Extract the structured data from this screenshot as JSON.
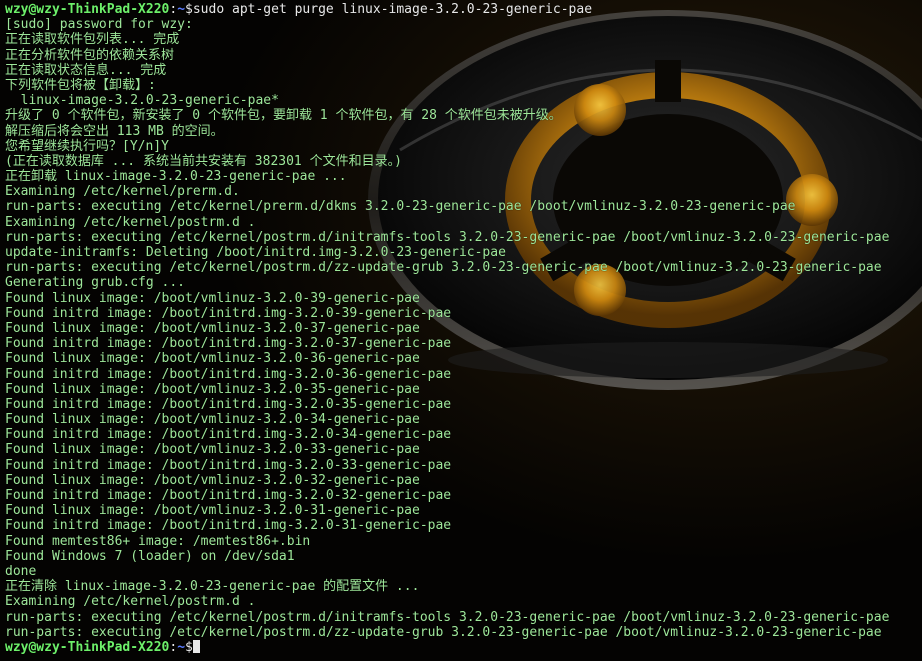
{
  "terminal": {
    "prompt_user": "wzy@wzy-ThinkPad-X220",
    "prompt_sep": ":",
    "prompt_path": "~",
    "prompt_dollar": "$",
    "command": "sudo apt-get purge linux-image-3.2.0-23-generic-pae",
    "output": [
      "[sudo] password for wzy:",
      "正在读取软件包列表... 完成",
      "正在分析软件包的依赖关系树",
      "正在读取状态信息... 完成",
      "下列软件包将被【卸载】:",
      "  linux-image-3.2.0-23-generic-pae*",
      "升级了 0 个软件包，新安装了 0 个软件包，要卸载 1 个软件包，有 28 个软件包未被升级。",
      "解压缩后将会空出 113 MB 的空间。",
      "您希望继续执行吗？[Y/n]Y",
      "(正在读取数据库 ... 系统当前共安装有 382301 个文件和目录。)",
      "正在卸载 linux-image-3.2.0-23-generic-pae ...",
      "Examining /etc/kernel/prerm.d.",
      "run-parts: executing /etc/kernel/prerm.d/dkms 3.2.0-23-generic-pae /boot/vmlinuz-3.2.0-23-generic-pae",
      "Examining /etc/kernel/postrm.d .",
      "run-parts: executing /etc/kernel/postrm.d/initramfs-tools 3.2.0-23-generic-pae /boot/vmlinuz-3.2.0-23-generic-pae",
      "update-initramfs: Deleting /boot/initrd.img-3.2.0-23-generic-pae",
      "run-parts: executing /etc/kernel/postrm.d/zz-update-grub 3.2.0-23-generic-pae /boot/vmlinuz-3.2.0-23-generic-pae",
      "Generating grub.cfg ...",
      "Found linux image: /boot/vmlinuz-3.2.0-39-generic-pae",
      "Found initrd image: /boot/initrd.img-3.2.0-39-generic-pae",
      "Found linux image: /boot/vmlinuz-3.2.0-37-generic-pae",
      "Found initrd image: /boot/initrd.img-3.2.0-37-generic-pae",
      "Found linux image: /boot/vmlinuz-3.2.0-36-generic-pae",
      "Found initrd image: /boot/initrd.img-3.2.0-36-generic-pae",
      "Found linux image: /boot/vmlinuz-3.2.0-35-generic-pae",
      "Found initrd image: /boot/initrd.img-3.2.0-35-generic-pae",
      "Found linux image: /boot/vmlinuz-3.2.0-34-generic-pae",
      "Found initrd image: /boot/initrd.img-3.2.0-34-generic-pae",
      "Found linux image: /boot/vmlinuz-3.2.0-33-generic-pae",
      "Found initrd image: /boot/initrd.img-3.2.0-33-generic-pae",
      "Found linux image: /boot/vmlinuz-3.2.0-32-generic-pae",
      "Found initrd image: /boot/initrd.img-3.2.0-32-generic-pae",
      "Found linux image: /boot/vmlinuz-3.2.0-31-generic-pae",
      "Found initrd image: /boot/initrd.img-3.2.0-31-generic-pae",
      "Found memtest86+ image: /memtest86+.bin",
      "Found Windows 7 (loader) on /dev/sda1",
      "done",
      "正在清除 linux-image-3.2.0-23-generic-pae 的配置文件 ...",
      "Examining /etc/kernel/postrm.d .",
      "run-parts: executing /etc/kernel/postrm.d/initramfs-tools 3.2.0-23-generic-pae /boot/vmlinuz-3.2.0-23-generic-pae",
      "run-parts: executing /etc/kernel/postrm.d/zz-update-grub 3.2.0-23-generic-pae /boot/vmlinuz-3.2.0-23-generic-pae"
    ]
  },
  "colors": {
    "output_text": "#9ee79a",
    "prompt_user": "#6df06a",
    "prompt_path": "#5a7cff",
    "command_text": "#e8e8e8",
    "background": "#050403",
    "logo_accent": "#d9a21a"
  },
  "icons": {
    "wallpaper_logo": "ubuntu-circle-of-friends-icon",
    "cursor": "block-cursor-icon"
  }
}
